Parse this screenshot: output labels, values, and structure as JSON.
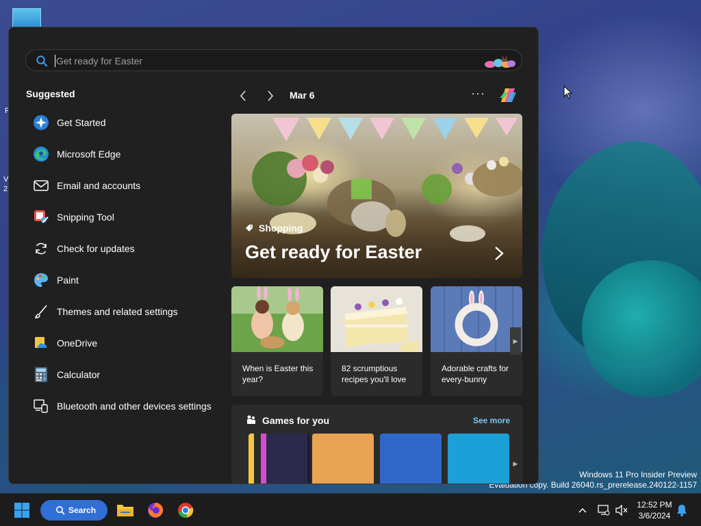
{
  "desktop": {
    "fragment_1": "F",
    "fragment_2": "V",
    "fragment_3": "2",
    "watermark_line1": "Windows 11 Pro Insider Preview",
    "watermark_line2": "Evaluation copy. Build 26040.rs_prerelease.240122-1157"
  },
  "start_panel": {
    "search": {
      "placeholder": "Get ready for Easter"
    },
    "suggested_title": "Suggested",
    "apps": [
      {
        "label": "Get Started",
        "icon": "get-started-icon"
      },
      {
        "label": "Microsoft Edge",
        "icon": "edge-icon"
      },
      {
        "label": "Email and accounts",
        "icon": "mail-icon"
      },
      {
        "label": "Snipping Tool",
        "icon": "snipping-tool-icon"
      },
      {
        "label": "Check for updates",
        "icon": "refresh-icon"
      },
      {
        "label": "Paint",
        "icon": "paint-icon"
      },
      {
        "label": "Themes and related settings",
        "icon": "brush-icon"
      },
      {
        "label": "OneDrive",
        "icon": "onedrive-icon"
      },
      {
        "label": "Calculator",
        "icon": "calculator-icon"
      },
      {
        "label": "Bluetooth and other devices settings",
        "icon": "devices-icon"
      }
    ],
    "feed": {
      "date": "Mar 6",
      "more": "···",
      "hero": {
        "tag": "Shopping",
        "title": "Get ready for Easter"
      },
      "cards": [
        {
          "title": "When is Easter this year?"
        },
        {
          "title": "82 scrumptious recipes you'll love"
        },
        {
          "title": "Adorable crafts for every-bunny"
        }
      ],
      "games": {
        "title": "Games for you",
        "see_more": "See more"
      }
    }
  },
  "taskbar": {
    "search_label": "Search",
    "time": "12:52 PM",
    "date": "3/6/2024"
  },
  "colors": {
    "accent": "#2f6fd6",
    "link": "#7cc4f5",
    "panel_bg": "#202020",
    "card_bg": "#2b2b2b"
  }
}
